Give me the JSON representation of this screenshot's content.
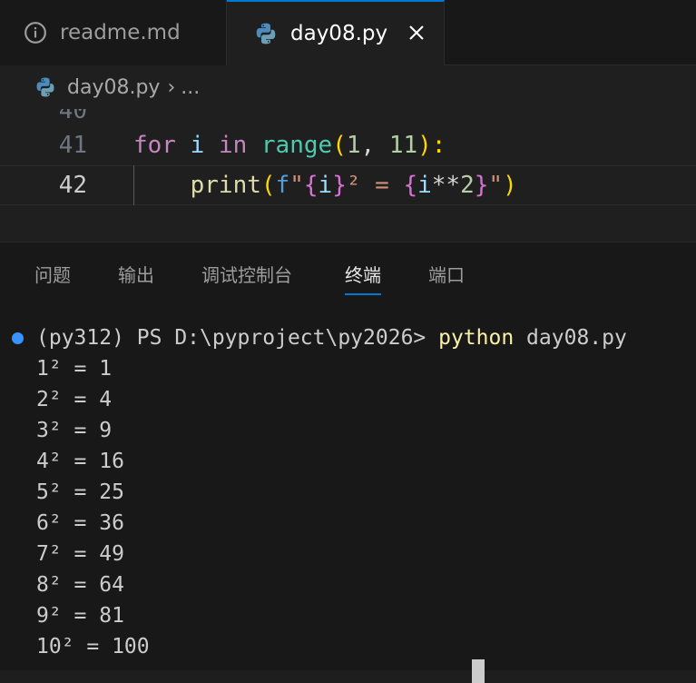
{
  "tabs": [
    {
      "label": "readme.md",
      "icon": "info-icon"
    },
    {
      "label": "day08.py",
      "icon": "python-icon",
      "close_label": "×"
    }
  ],
  "breadcrumb": {
    "file": "day08.py",
    "separator": "›",
    "more": "..."
  },
  "editor": {
    "partial_line_number": "40",
    "lines": [
      {
        "number": "41",
        "tokens": [
          "for",
          " ",
          "i",
          " ",
          "in",
          " ",
          "range",
          "(",
          "1",
          ", ",
          "11",
          "):"
        ]
      },
      {
        "number": "42",
        "tokens": [
          "    ",
          "print",
          "(",
          "f",
          "\"",
          "{",
          "i",
          "}",
          "²",
          " = ",
          "{",
          "i",
          "**",
          "2",
          "}",
          "\"",
          ")"
        ]
      }
    ]
  },
  "panel": {
    "tabs": [
      "问题",
      "输出",
      "调试控制台",
      "终端",
      "端口"
    ],
    "active_tab": "终端"
  },
  "terminal": {
    "prompt": "(py312) PS D:\\pyproject\\py2026> ",
    "command_exe": "python",
    "command_arg": " day08.py",
    "output": [
      "1² = 1",
      "2² = 4",
      "3² = 9",
      "4² = 16",
      "5² = 25",
      "6² = 36",
      "7² = 49",
      "8² = 64",
      "9² = 81",
      "10² = 100"
    ]
  }
}
